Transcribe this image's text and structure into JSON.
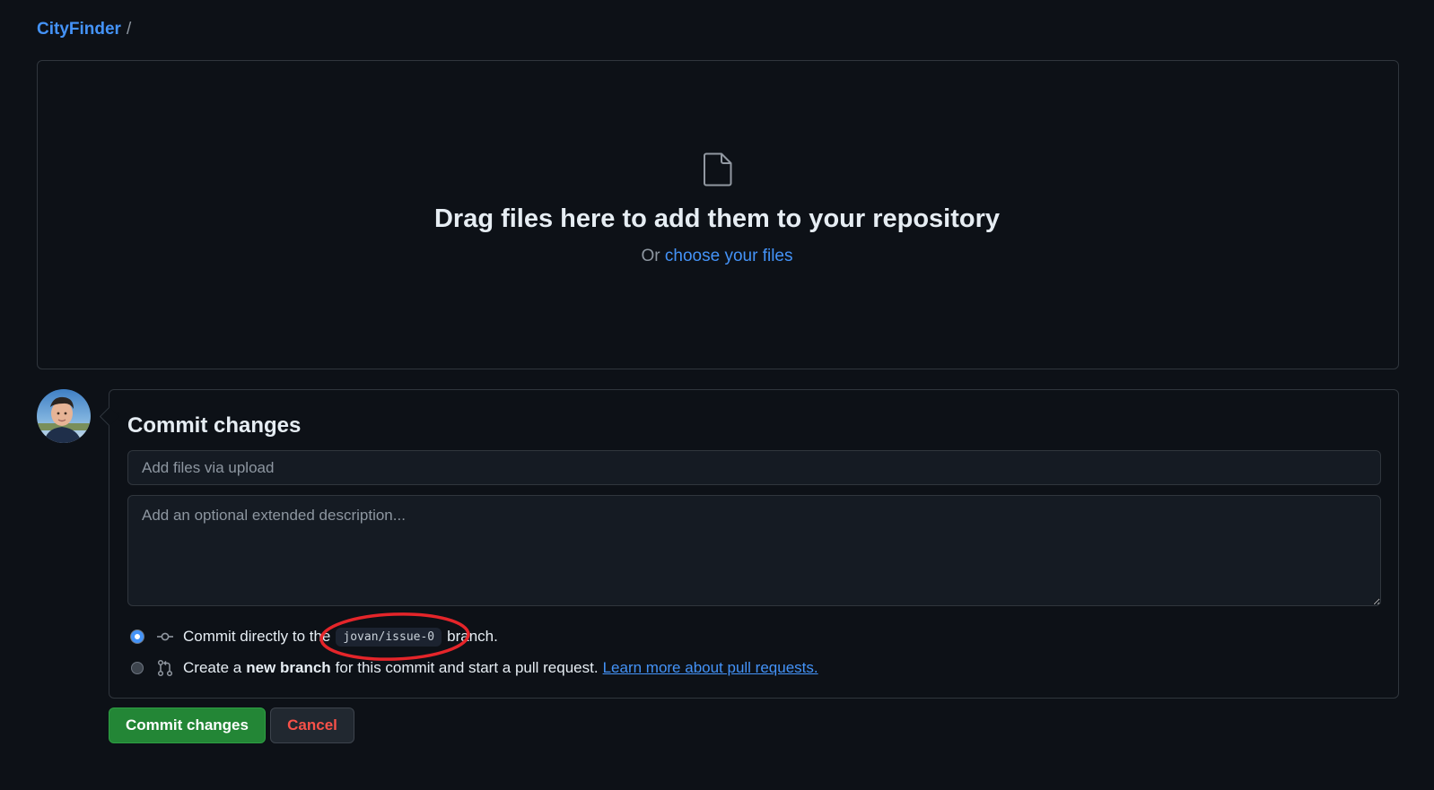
{
  "breadcrumb": {
    "repo": "CityFinder",
    "separator": "/"
  },
  "dropzone": {
    "icon": "file-icon",
    "title": "Drag files here to add them to your repository",
    "sub_prefix": "Or",
    "sub_link": "choose your files"
  },
  "commit": {
    "title": "Commit changes",
    "summary_placeholder": "Add files via upload",
    "summary_value": "",
    "description_placeholder": "Add an optional extended description...",
    "description_value": "",
    "options": [
      {
        "selected": true,
        "icon": "git-commit-icon",
        "text_before": "Commit directly to the",
        "branch": "jovan/issue-0",
        "text_after": "branch."
      },
      {
        "selected": false,
        "icon": "git-pull-request-icon",
        "text_before": "Create a",
        "bold": "new branch",
        "text_after": "for this commit and start a pull request.",
        "link": "Learn more about pull requests."
      }
    ]
  },
  "buttons": {
    "commit": "Commit changes",
    "cancel": "Cancel"
  },
  "colors": {
    "background": "#0d1117",
    "link": "#4493f8",
    "primary_button": "#238636",
    "danger_text": "#f85149",
    "annotation": "#e5252a"
  }
}
